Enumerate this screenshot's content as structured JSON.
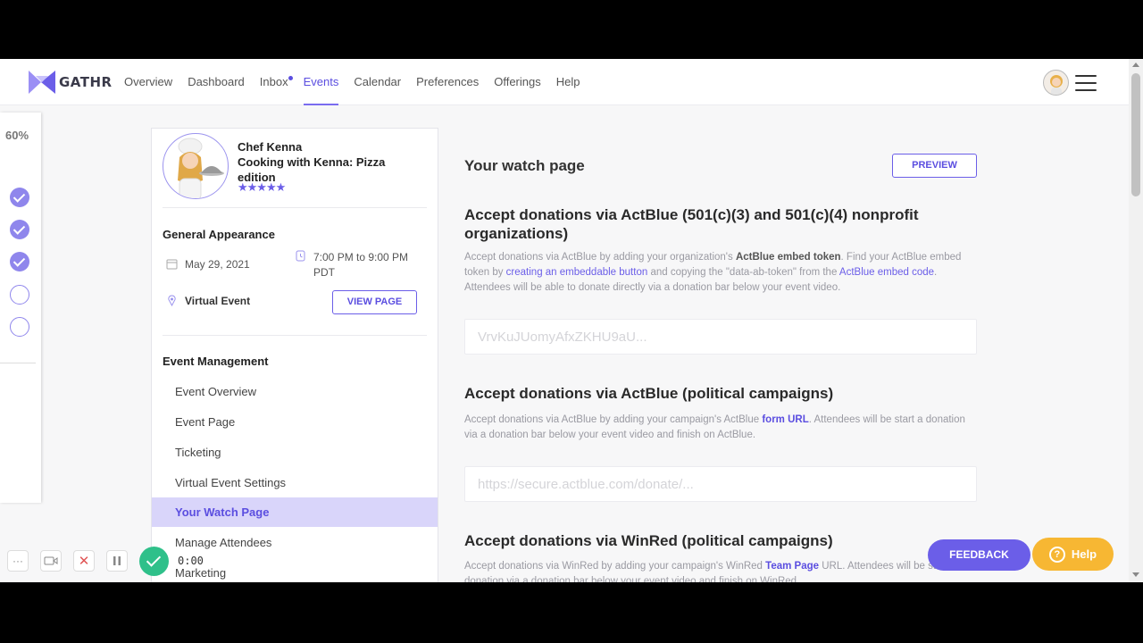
{
  "brand": {
    "name": "GATHR",
    "accent": "#6b5ee8"
  },
  "nav": {
    "links": [
      {
        "label": "Overview"
      },
      {
        "label": "Dashboard"
      },
      {
        "label": "Inbox"
      },
      {
        "label": "Events"
      },
      {
        "label": "Calendar"
      },
      {
        "label": "Preferences"
      },
      {
        "label": "Offerings"
      },
      {
        "label": "Help"
      }
    ],
    "active": "Events"
  },
  "tracker": {
    "percent": "60%",
    "steps_done": 3,
    "steps_total": 5
  },
  "event": {
    "host": "Chef Kenna",
    "title": "Cooking with Kenna: Pizza edition",
    "stars": "★★★★★",
    "rating": 5
  },
  "appearance": {
    "heading": "General Appearance",
    "date": "May 29, 2021",
    "time": "7:00 PM to 9:00 PM PDT",
    "location": "Virtual Event",
    "view_page_label": "VIEW PAGE"
  },
  "management": {
    "heading": "Event Management",
    "items": [
      {
        "label": "Event Overview"
      },
      {
        "label": "Event Page"
      },
      {
        "label": "Ticketing"
      },
      {
        "label": "Virtual Event Settings"
      },
      {
        "label": "Your Watch Page"
      },
      {
        "label": "Manage Attendees"
      },
      {
        "label": "Marketing"
      }
    ],
    "active": "Your Watch Page"
  },
  "main": {
    "title": "Your watch page",
    "preview_label": "PREVIEW",
    "sections": [
      {
        "heading": "Accept donations via ActBlue (501(c)(3) and 501(c)(4) nonprofit organizations)",
        "desc": {
          "t1": "Accept donations via ActBlue by adding your organization's ",
          "b1": "ActBlue embed token",
          "t2": ". Find your ActBlue embed token by ",
          "l1": "creating an embeddable button",
          "t3": " and copying the \"data-ab-token\" from the ",
          "l2": "ActBlue embed code",
          "t4": ". Attendees will be able to donate directly via a donation bar below your event video."
        },
        "placeholder": "VrvKuJUomyAfxZKHU9aU..."
      },
      {
        "heading": "Accept donations via ActBlue (political campaigns)",
        "desc": {
          "t1": "Accept donations via ActBlue by adding your campaign's ActBlue ",
          "l1": "form URL",
          "t2": ". Attendees will be start a donation via a donation bar below your event video and finish on ActBlue."
        },
        "placeholder": "https://secure.actblue.com/donate/..."
      },
      {
        "heading": "Accept donations via WinRed (political campaigns)",
        "desc": {
          "t1": "Accept donations via WinRed by adding your campaign's WinRed ",
          "l1": "Team Page",
          "t2": " URL. Attendees will be start a donation via a donation bar below your event video and finish on WinRed."
        }
      }
    ]
  },
  "floating": {
    "feedback_label": "FEEDBACK",
    "help_label": "Help"
  },
  "recorder": {
    "time": "0:00"
  }
}
